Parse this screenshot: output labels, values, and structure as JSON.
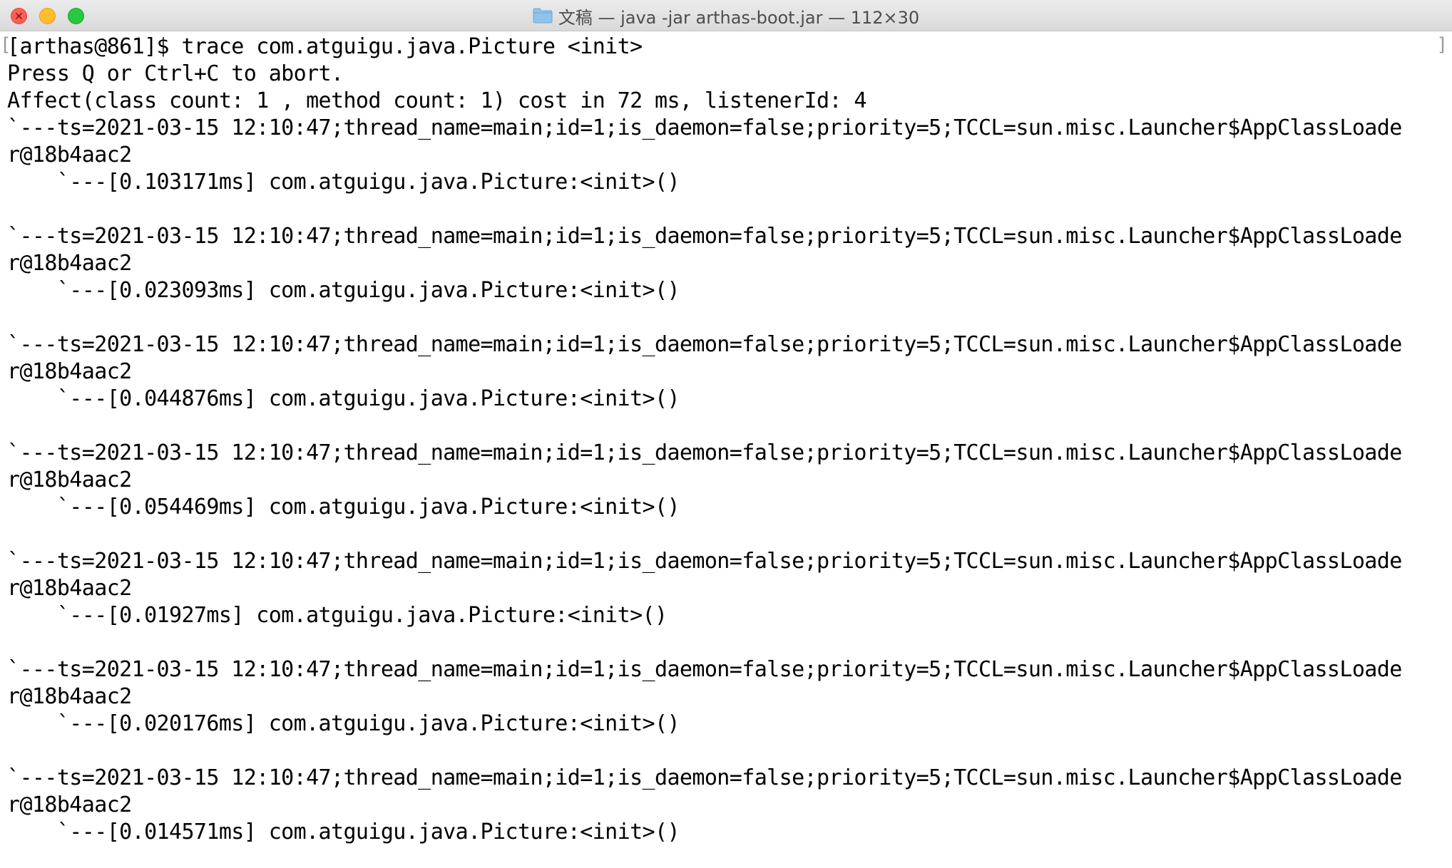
{
  "window": {
    "title": "文稿 — java -jar arthas-boot.jar — 112×30",
    "folder_icon": "folder-icon",
    "colors": {
      "close": "#fd5f57",
      "minimize": "#febc2e",
      "zoom": "#28c840"
    }
  },
  "terminal": {
    "lines": [
      "[arthas@861]$ trace com.atguigu.java.Picture <init>",
      "Press Q or Ctrl+C to abort.",
      "Affect(class count: 1 , method count: 1) cost in 72 ms, listenerId: 4",
      "`---ts=2021-03-15 12:10:47;thread_name=main;id=1;is_daemon=false;priority=5;TCCL=sun.misc.Launcher$AppClassLoade",
      "r@18b4aac2",
      "    `---[0.103171ms] com.atguigu.java.Picture:<init>()",
      "",
      "`---ts=2021-03-15 12:10:47;thread_name=main;id=1;is_daemon=false;priority=5;TCCL=sun.misc.Launcher$AppClassLoade",
      "r@18b4aac2",
      "    `---[0.023093ms] com.atguigu.java.Picture:<init>()",
      "",
      "`---ts=2021-03-15 12:10:47;thread_name=main;id=1;is_daemon=false;priority=5;TCCL=sun.misc.Launcher$AppClassLoade",
      "r@18b4aac2",
      "    `---[0.044876ms] com.atguigu.java.Picture:<init>()",
      "",
      "`---ts=2021-03-15 12:10:47;thread_name=main;id=1;is_daemon=false;priority=5;TCCL=sun.misc.Launcher$AppClassLoade",
      "r@18b4aac2",
      "    `---[0.054469ms] com.atguigu.java.Picture:<init>()",
      "",
      "`---ts=2021-03-15 12:10:47;thread_name=main;id=1;is_daemon=false;priority=5;TCCL=sun.misc.Launcher$AppClassLoade",
      "r@18b4aac2",
      "    `---[0.01927ms] com.atguigu.java.Picture:<init>()",
      "",
      "`---ts=2021-03-15 12:10:47;thread_name=main;id=1;is_daemon=false;priority=5;TCCL=sun.misc.Launcher$AppClassLoade",
      "r@18b4aac2",
      "    `---[0.020176ms] com.atguigu.java.Picture:<init>()",
      "",
      "`---ts=2021-03-15 12:10:47;thread_name=main;id=1;is_daemon=false;priority=5;TCCL=sun.misc.Launcher$AppClassLoade",
      "r@18b4aac2",
      "    `---[0.014571ms] com.atguigu.java.Picture:<init>()"
    ]
  }
}
